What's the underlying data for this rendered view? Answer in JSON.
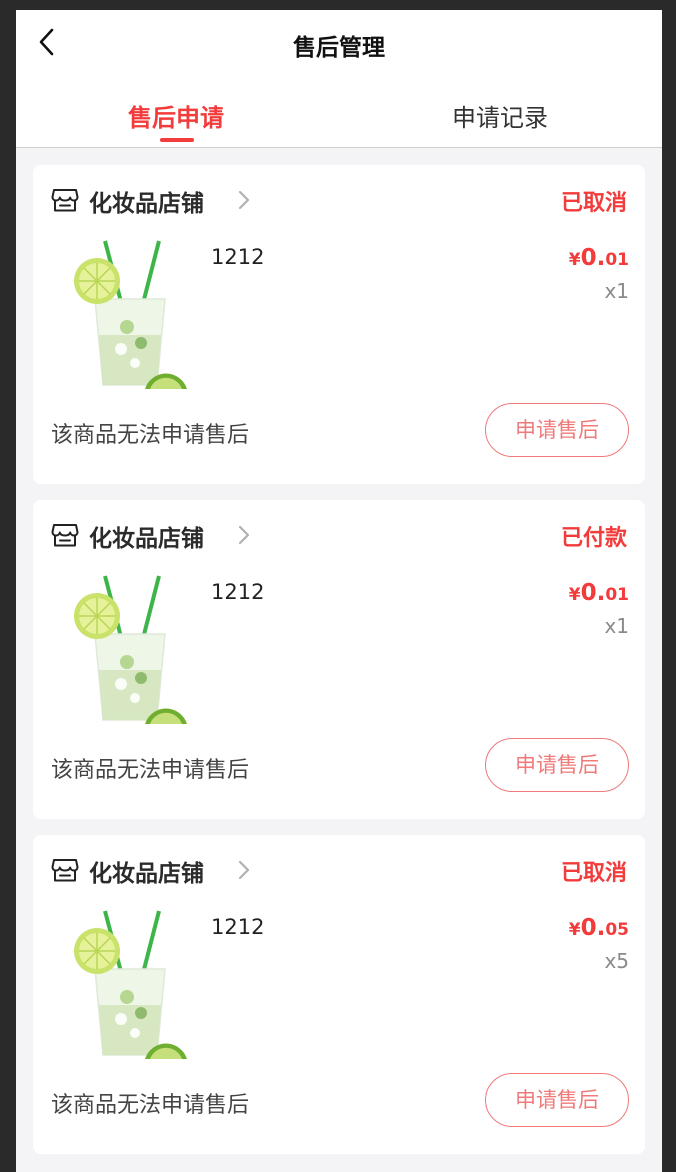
{
  "header": {
    "title": "售后管理",
    "back_icon": "chevron-left-icon"
  },
  "tabs": [
    {
      "label": "售后申请",
      "active": true
    },
    {
      "label": "申请记录",
      "active": false
    }
  ],
  "colors": {
    "accent": "#f23b3b",
    "button_outline": "#f07a7a",
    "page_bg": "#f4f4f6",
    "muted_text": "#8a8a8a"
  },
  "orders": [
    {
      "shop_name": "化妆品店铺",
      "status": "已取消",
      "product_name": "1212",
      "price_symbol": "¥",
      "price_integer": "0.",
      "price_decimal": "01",
      "quantity": "x1",
      "notice": "该商品无法申请售后",
      "action_label": "申请售后"
    },
    {
      "shop_name": "化妆品店铺",
      "status": "已付款",
      "product_name": "1212",
      "price_symbol": "¥",
      "price_integer": "0.",
      "price_decimal": "01",
      "quantity": "x1",
      "notice": "该商品无法申请售后",
      "action_label": "申请售后"
    },
    {
      "shop_name": "化妆品店铺",
      "status": "已取消",
      "product_name": "1212",
      "price_symbol": "¥",
      "price_integer": "0.",
      "price_decimal": "05",
      "quantity": "x5",
      "notice": "该商品无法申请售后",
      "action_label": "申请售后"
    }
  ]
}
